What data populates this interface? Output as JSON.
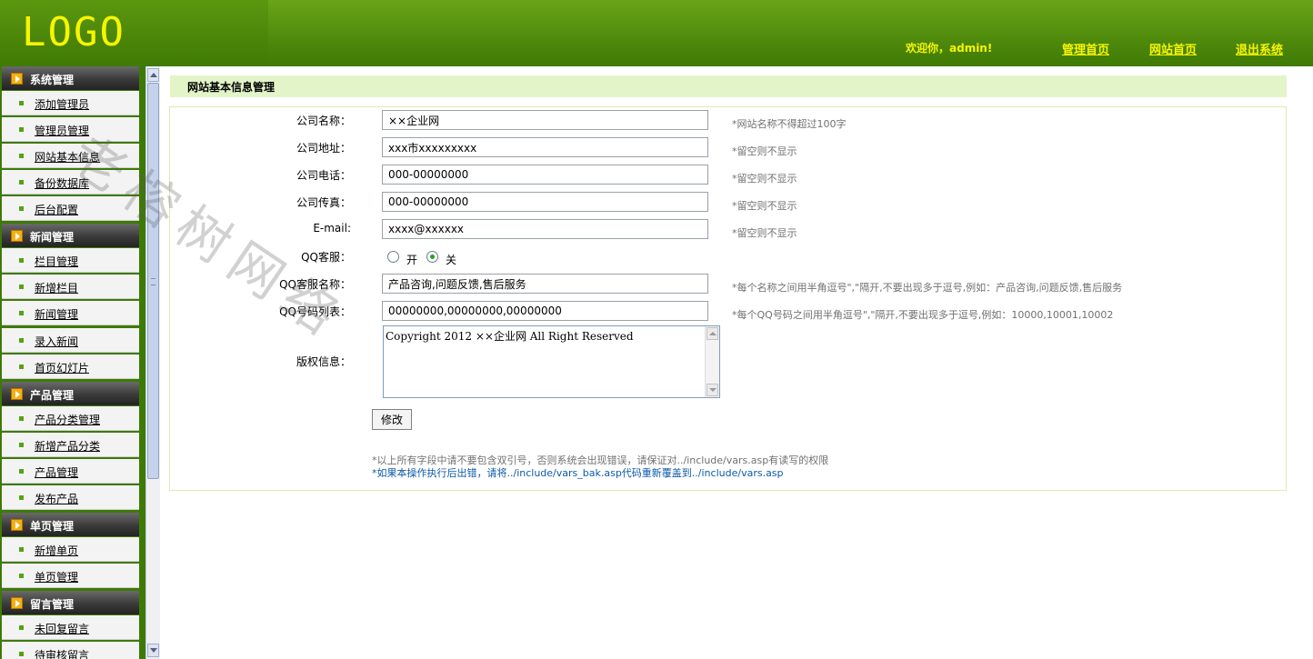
{
  "header": {
    "logo": "LOGO",
    "welcome": "欢迎你，admin!",
    "links": [
      "管理首页",
      "网站首页",
      "退出系统"
    ]
  },
  "sidebar": {
    "sections": [
      {
        "title": "系统管理",
        "items": [
          "添加管理员",
          "管理员管理",
          "网站基本信息",
          "备份数据库",
          "后台配置"
        ]
      },
      {
        "title": "新闻管理",
        "items": [
          "栏目管理",
          "新增栏目",
          "新闻管理",
          "录入新闻",
          "首页幻灯片"
        ]
      },
      {
        "title": "产品管理",
        "items": [
          "产品分类管理",
          "新增产品分类",
          "产品管理",
          "发布产品"
        ]
      },
      {
        "title": "单页管理",
        "items": [
          "新增单页",
          "单页管理"
        ]
      },
      {
        "title": "留言管理",
        "items": [
          "未回复留言",
          "待审核留言"
        ]
      }
    ]
  },
  "page": {
    "title": "网站基本信息管理"
  },
  "form": {
    "company_name": {
      "label": "公司名称：",
      "value": "××企业网",
      "hint": "*网站名称不得超过100字"
    },
    "address": {
      "label": "公司地址：",
      "value": "xxx市xxxxxxxxx",
      "hint": "*留空则不显示"
    },
    "phone": {
      "label": "公司电话：",
      "value": "000-00000000",
      "hint": "*留空则不显示"
    },
    "fax": {
      "label": "公司传真：",
      "value": "000-00000000",
      "hint": "*留空则不显示"
    },
    "email": {
      "label": "E-mail:",
      "value": "xxxx@xxxxxx",
      "hint": "*留空则不显示"
    },
    "qq_service": {
      "label": "QQ客服：",
      "options": [
        "开",
        "关"
      ],
      "selected": "关"
    },
    "qq_names": {
      "label": "QQ客服名称：",
      "value": "产品咨询,问题反馈,售后服务",
      "hint": "*每个名称之间用半角逗号\",\"隔开,不要出现多于逗号,例如：产品咨询,问题反馈,售后服务"
    },
    "qq_numbers": {
      "label": "QQ号码列表：",
      "value": "00000000,00000000,00000000",
      "hint": "*每个QQ号码之间用半角逗号\",\"隔开,不要出现多于逗号,例如：10000,10001,10002"
    },
    "copyright": {
      "label": "版权信息：",
      "value": "Copyright 2012 ××企业网 All Right Reserved"
    },
    "submit_label": "修改",
    "note1": "*以上所有字段中请不要包含双引号，否则系统会出现错误，请保证对../include/vars.asp有读写的权限",
    "note2": "*如果本操作执行后出错，请将../include/vars_bak.asp代码重新覆盖到../include/vars.asp"
  },
  "watermark": "老榕树网络",
  "colors": {
    "header_green": "#4f8a0c",
    "logo_yellow": "#f7f500",
    "sidebar_green": "#3d7a05",
    "title_bar_bg": "#e3f5c8",
    "note_blue": "#0c5aa8"
  }
}
